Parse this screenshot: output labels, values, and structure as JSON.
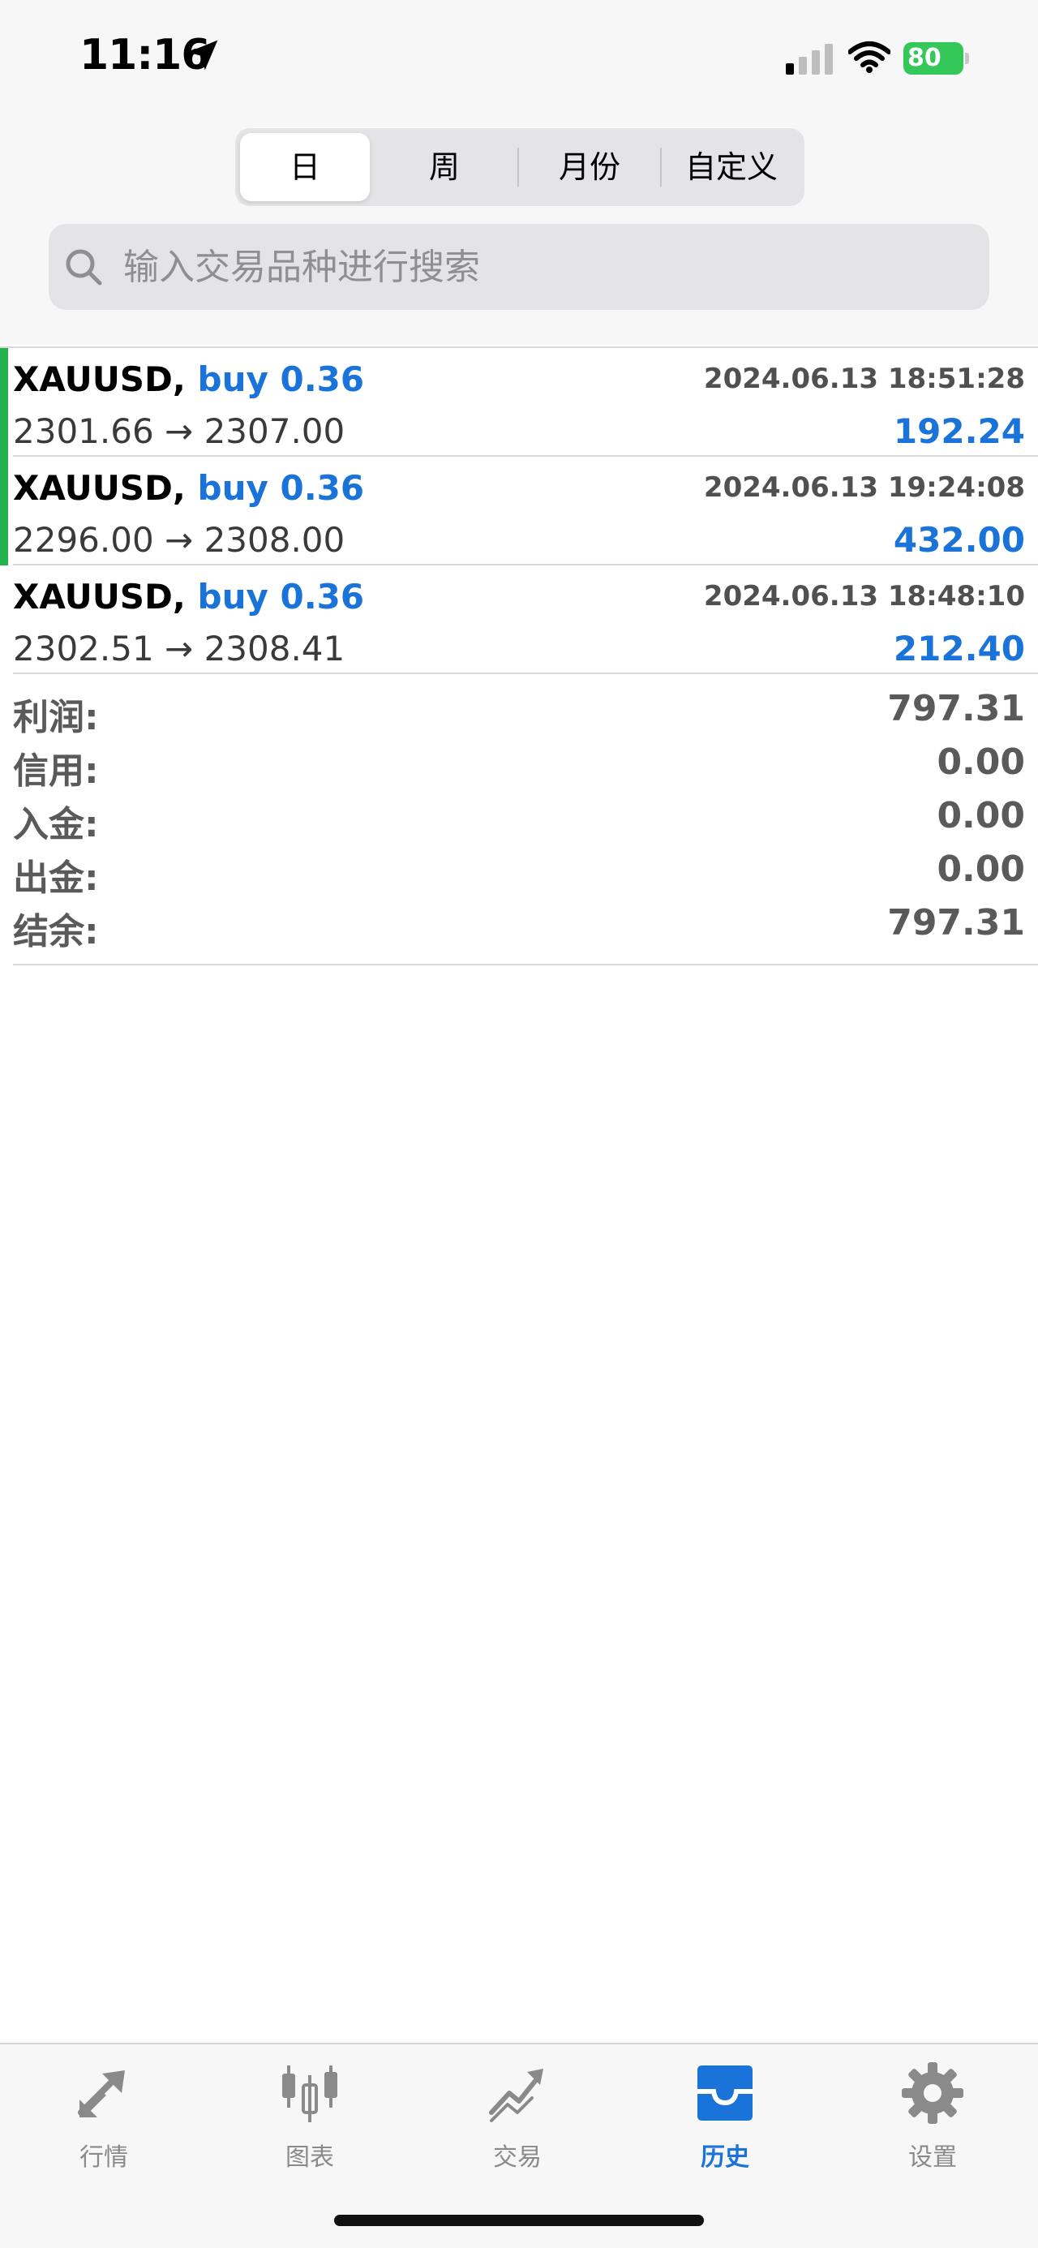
{
  "status_bar": {
    "time": "11:16",
    "battery": "80"
  },
  "segments": [
    {
      "label": "日"
    },
    {
      "label": "周"
    },
    {
      "label": "月份"
    },
    {
      "label": "自定义"
    }
  ],
  "search": {
    "placeholder": "输入交易品种进行搜索"
  },
  "trades": [
    {
      "symbol": "XAUUSD,",
      "side": "buy 0.36",
      "time": "2024.06.13 18:51:28",
      "prices": "2301.66 → 2307.00",
      "profit": "192.24",
      "bar_color": "#22b14c"
    },
    {
      "symbol": "XAUUSD,",
      "side": "buy 0.36",
      "time": "2024.06.13 19:24:08",
      "prices": "2296.00 → 2308.00",
      "profit": "432.00",
      "bar_color": "#22b14c"
    },
    {
      "symbol": "XAUUSD,",
      "side": "buy 0.36",
      "time": "2024.06.13 18:48:10",
      "prices": "2302.51 → 2308.41",
      "profit": "212.40"
    }
  ],
  "summary": [
    {
      "label": "利润:",
      "value": "797.31"
    },
    {
      "label": "信用:",
      "value": "0.00"
    },
    {
      "label": "入金:",
      "value": "0.00"
    },
    {
      "label": "出金:",
      "value": "0.00"
    },
    {
      "label": "结余:",
      "value": "797.31"
    }
  ],
  "tabs": [
    {
      "label": "行情",
      "icon": "quotes-arrows-icon"
    },
    {
      "label": "图表",
      "icon": "candlestick-chart-icon"
    },
    {
      "label": "交易",
      "icon": "trade-chart-icon"
    },
    {
      "label": "历史",
      "icon": "history-inbox-icon",
      "active": true
    },
    {
      "label": "设置",
      "icon": "gear-icon"
    }
  ],
  "colors": {
    "accent": "#1a73d9",
    "buy_bar": "#22b14c",
    "battery": "#34c759"
  }
}
